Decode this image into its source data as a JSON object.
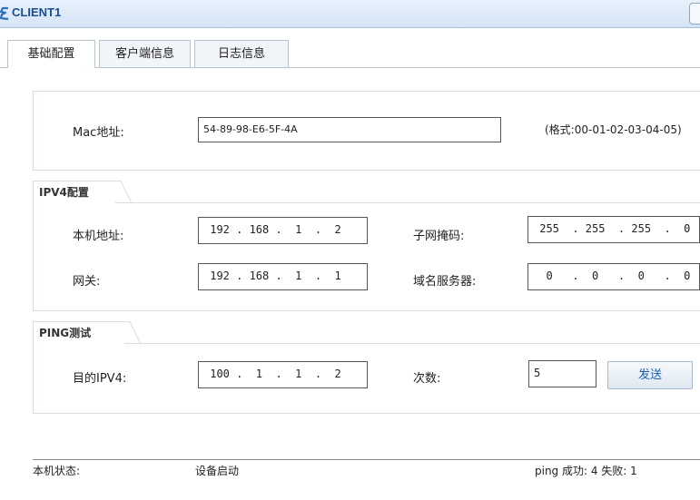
{
  "window": {
    "title": "CLIENT1"
  },
  "tabs": [
    {
      "label": "基础配置",
      "active": true
    },
    {
      "label": "客户端信息",
      "active": false
    },
    {
      "label": "日志信息",
      "active": false
    }
  ],
  "mac": {
    "label": "Mac地址:",
    "value": "54-89-98-E6-5F-4A",
    "hint": "(格式:00-01-02-03-04-05)"
  },
  "ipv4": {
    "legend": "IPV4配置",
    "local_label": "本机地址:",
    "local_value": " 192 . 168 .  1  .  2",
    "mask_label": "子网掩码:",
    "mask_value": " 255  . 255  . 255  .  0",
    "gateway_label": "网关:",
    "gateway_value": " 192 . 168 .  1  .  1",
    "dns_label": "域名服务器:",
    "dns_value": "  0   .  0   .  0   .  0"
  },
  "ping": {
    "legend": "PING测试",
    "dest_label": "目的IPV4:",
    "dest_value": " 100 .  1  .  1  .  2",
    "count_label": "次数:",
    "count_value": "5",
    "send_label": "发送"
  },
  "status": {
    "label": "本机状态:",
    "value": "设备启动",
    "ping_result": "ping 成功: 4   失败: 1"
  }
}
